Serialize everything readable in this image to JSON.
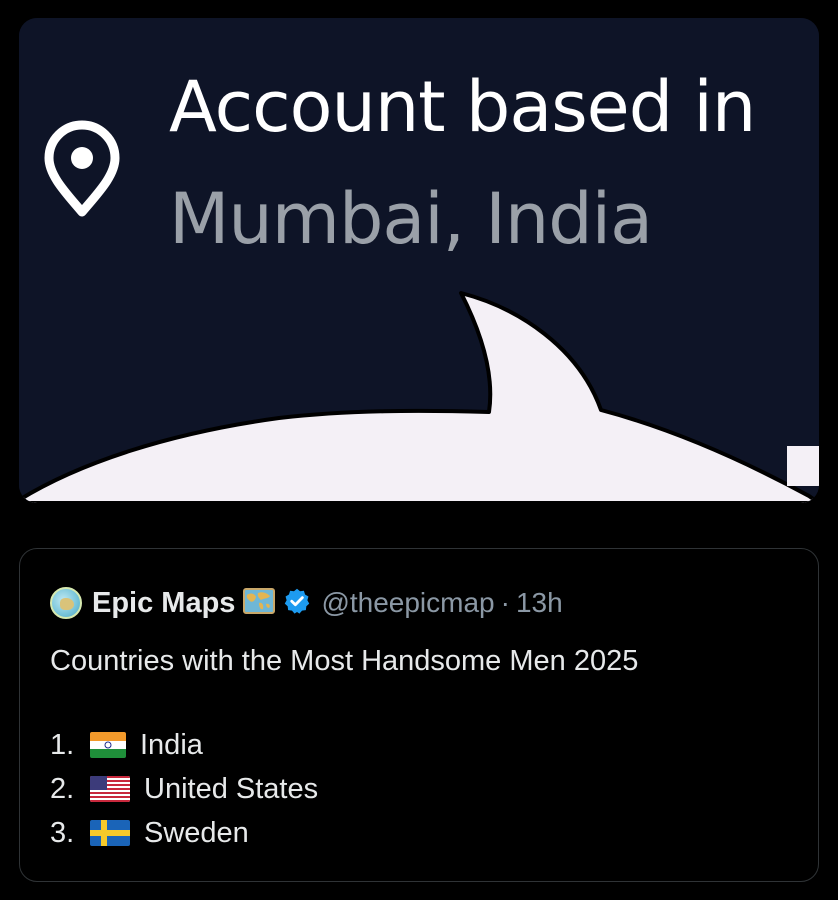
{
  "media": {
    "headline": "Account based in",
    "location": "Mumbai, India",
    "icon": "location-pin-icon",
    "colors": {
      "background": "#0e1427",
      "bubble": "#f4f0f6",
      "headline": "#ffffff",
      "location": "#9aa0a8"
    }
  },
  "quote": {
    "avatar_icon": "globe-avatar",
    "display_name": "Epic Maps",
    "name_emoji": "world-map-icon",
    "verified_icon": "verified-badge-icon",
    "handle": "@theepicmap",
    "separator": "·",
    "time": "13h",
    "text": "Countries with the Most Handsome Men 2025",
    "list": [
      {
        "rank": "1.",
        "flag": "india-flag-icon",
        "country": "India"
      },
      {
        "rank": "2.",
        "flag": "usa-flag-icon",
        "country": "United States"
      },
      {
        "rank": "3.",
        "flag": "sweden-flag-icon",
        "country": "Sweden"
      }
    ],
    "colors": {
      "text": "#e7e9ea",
      "muted": "#8b98a5",
      "border": "#2f3336",
      "verified": "#1d9bf0"
    }
  }
}
